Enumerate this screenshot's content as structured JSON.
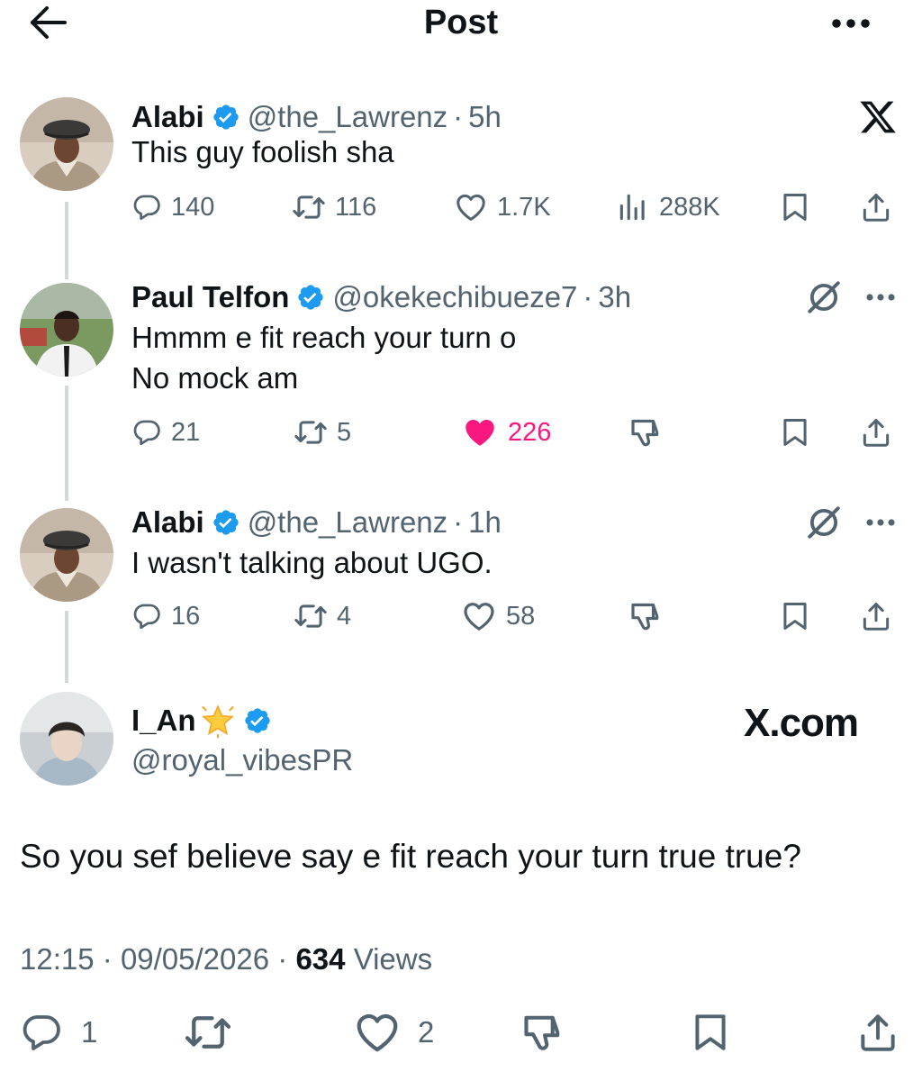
{
  "header": {
    "title": "Post",
    "back_icon": "arrow-left-icon",
    "more_icon": "more-horizontal-icon"
  },
  "thread": [
    {
      "name": "Alabi",
      "handle": "@the_Lawrenz",
      "sep": "·",
      "time": "5h",
      "lines": [
        "This guy foolish sha"
      ],
      "stats": {
        "replies": "140",
        "reposts": "116",
        "likes": "1.7K",
        "views": "288K"
      },
      "liked": false
    },
    {
      "name": "Paul Telfon",
      "handle": "@okekechibueze7",
      "sep": "·",
      "time": "3h",
      "lines": [
        "Hmmm e fit reach your turn o",
        "No mock am"
      ],
      "stats": {
        "replies": "21",
        "reposts": "5",
        "likes": "226"
      },
      "liked": true
    },
    {
      "name": "Alabi",
      "handle": "@the_Lawrenz",
      "sep": "·",
      "time": "1h",
      "lines": [
        "I wasn't talking about UGO."
      ],
      "stats": {
        "replies": "16",
        "reposts": "4",
        "likes": "58"
      },
      "liked": false
    }
  ],
  "main": {
    "name": "I_An",
    "handle": "@royal_vibesPR",
    "watermark": "X.com",
    "text": "So you sef believe say e fit reach your turn true true?",
    "time": "12:15",
    "sep": "·",
    "date": "09/05/2026",
    "views_count": "634",
    "views_label": "Views",
    "stats": {
      "replies": "1",
      "likes": "2"
    }
  },
  "colors": {
    "text": "#0f1419",
    "muted": "#536471",
    "verified": "#1d9bf0",
    "like": "#f91880",
    "thread_line": "#cfd9de"
  }
}
